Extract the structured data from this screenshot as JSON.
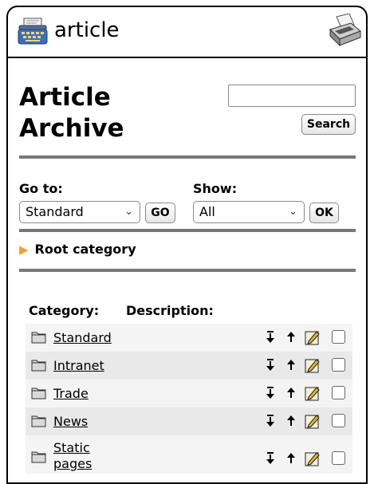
{
  "app": {
    "title": "article"
  },
  "icons": {
    "app": "typewriter-icon",
    "print": "printer-icon"
  },
  "colors": {
    "accent_arrow": "#f0a030",
    "rule": "#777777",
    "row_alt": "#e9e9e9"
  },
  "page": {
    "title_line1": "Article",
    "title_line2": "Archive"
  },
  "search": {
    "value": "",
    "placeholder": "",
    "button_label": "Search"
  },
  "goto": {
    "label": "Go to:",
    "selected": "Standard",
    "button_label": "GO"
  },
  "show": {
    "label": "Show:",
    "selected": "All",
    "button_label": "OK"
  },
  "breadcrumb": {
    "label": "Root category"
  },
  "table": {
    "headers": {
      "category": "Category:",
      "description": "Description:"
    },
    "rows": [
      {
        "name": "Standard",
        "description": ""
      },
      {
        "name": "Intranet",
        "description": ""
      },
      {
        "name": "Trade",
        "description": ""
      },
      {
        "name": "News",
        "description": ""
      },
      {
        "name": "Static pages",
        "description": ""
      }
    ]
  }
}
